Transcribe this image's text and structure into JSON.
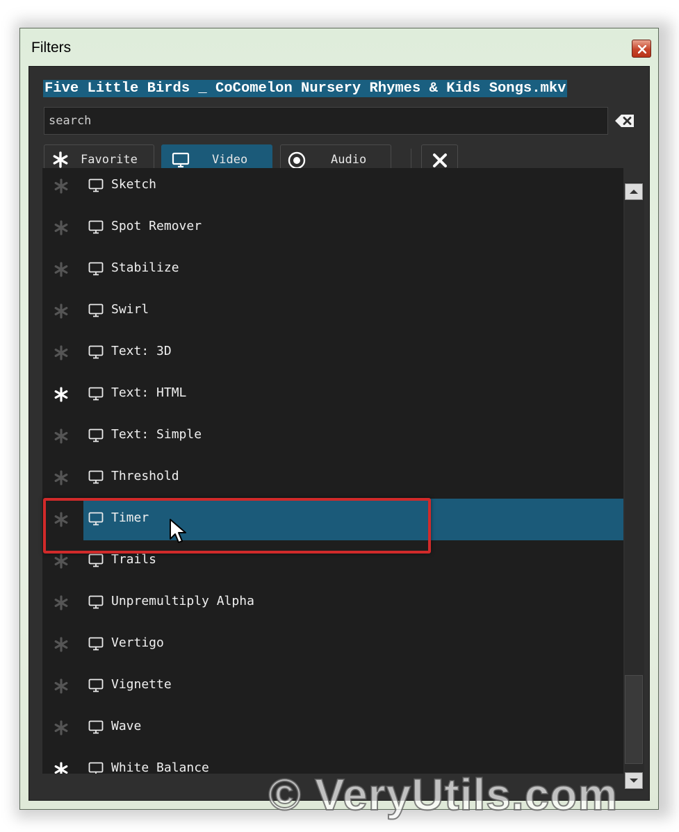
{
  "window": {
    "title": "Filters"
  },
  "file": {
    "name": "Five Little Birds _ CoComelon Nursery Rhymes & Kids Songs.mkv"
  },
  "search": {
    "placeholder": "search",
    "value": ""
  },
  "tabs": [
    {
      "label": "Favorite",
      "icon": "asterisk-icon",
      "active": false
    },
    {
      "label": "Video",
      "icon": "monitor-icon",
      "active": true
    },
    {
      "label": "Audio",
      "icon": "speaker-icon",
      "active": false
    }
  ],
  "list": {
    "items": [
      {
        "label": "Sketch",
        "favorite": false
      },
      {
        "label": "Spot Remover",
        "favorite": false
      },
      {
        "label": "Stabilize",
        "favorite": false
      },
      {
        "label": "Swirl",
        "favorite": false
      },
      {
        "label": "Text: 3D",
        "favorite": false
      },
      {
        "label": "Text: HTML",
        "favorite": true
      },
      {
        "label": "Text: Simple",
        "favorite": false
      },
      {
        "label": "Threshold",
        "favorite": false
      },
      {
        "label": "Timer",
        "favorite": false,
        "selected": true
      },
      {
        "label": "Trails",
        "favorite": false
      },
      {
        "label": "Unpremultiply Alpha",
        "favorite": false
      },
      {
        "label": "Vertigo",
        "favorite": false
      },
      {
        "label": "Vignette",
        "favorite": false
      },
      {
        "label": "Wave",
        "favorite": false
      },
      {
        "label": "White Balance",
        "favorite": true
      }
    ]
  },
  "colors": {
    "selected_bg": "#1b5a79",
    "highlight_border": "#d12a2a",
    "favorite_on": "#ffffff",
    "favorite_off": "#555555"
  },
  "watermark": {
    "text": "© VeryUtils.com"
  }
}
